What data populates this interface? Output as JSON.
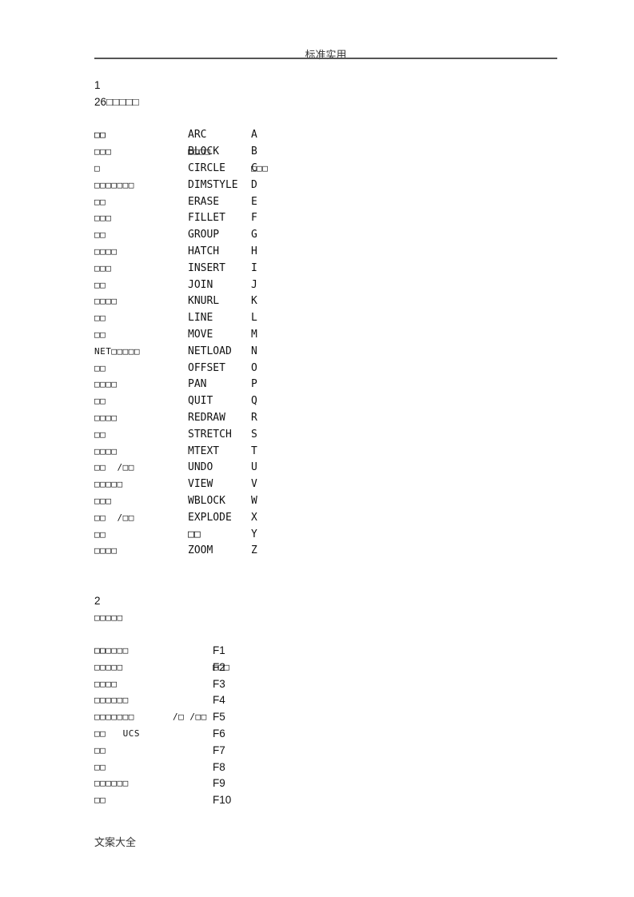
{
  "header": {
    "title": "标准实用"
  },
  "footer": {
    "text": "文案大全"
  },
  "section1": {
    "number": "1",
    "heading": "26□□□□□",
    "columns": [
      "□□",
      "□□□□",
      "□□□"
    ],
    "rows": [
      {
        "name": "□□",
        "command": "ARC",
        "key": "A"
      },
      {
        "name": "□□□",
        "command": "BLOCK",
        "key": "B"
      },
      {
        "name": "□",
        "command": "CIRCLE",
        "key": "C"
      },
      {
        "name": "□□□□□□□",
        "command": "DIMSTYLE",
        "key": "D"
      },
      {
        "name": "□□",
        "command": "ERASE",
        "key": "E"
      },
      {
        "name": "□□□",
        "command": "FILLET",
        "key": "F"
      },
      {
        "name": "□□",
        "command": "GROUP",
        "key": "G"
      },
      {
        "name": "□□□□",
        "command": "HATCH",
        "key": "H"
      },
      {
        "name": "□□□",
        "command": "INSERT",
        "key": "I"
      },
      {
        "name": "□□",
        "command": "JOIN",
        "key": "J"
      },
      {
        "name": "□□□□",
        "command": "KNURL",
        "key": "K"
      },
      {
        "name": "□□",
        "command": "LINE",
        "key": "L"
      },
      {
        "name": "□□",
        "command": "MOVE",
        "key": "M"
      },
      {
        "name": "NET□□□□□",
        "command": "NETLOAD",
        "key": "N"
      },
      {
        "name": "□□",
        "command": "OFFSET",
        "key": "O"
      },
      {
        "name": "□□□□",
        "command": "PAN",
        "key": "P"
      },
      {
        "name": "□□",
        "command": "QUIT",
        "key": "Q"
      },
      {
        "name": "□□□□",
        "command": "REDRAW",
        "key": "R"
      },
      {
        "name": "□□",
        "command": "STRETCH",
        "key": "S"
      },
      {
        "name": "□□□□",
        "command": "MTEXT",
        "key": "T"
      },
      {
        "name": "□□  /□□",
        "command": "UNDO",
        "key": "U"
      },
      {
        "name": "□□□□□",
        "command": "VIEW",
        "key": "V"
      },
      {
        "name": "□□□",
        "command": "WBLOCK",
        "key": "W"
      },
      {
        "name": "□□  /□□",
        "command": "EXPLODE",
        "key": "X"
      },
      {
        "name": "□□",
        "command": "□□",
        "key": "Y"
      },
      {
        "name": "□□□□",
        "command": "ZOOM",
        "key": "Z"
      }
    ]
  },
  "section2": {
    "number": "2",
    "heading": "□□□□□",
    "columns": [
      "□□",
      "□□□"
    ],
    "rows": [
      {
        "name": "□□□□□□",
        "mid": "",
        "key": "F1"
      },
      {
        "name": "□□□□□",
        "mid": "",
        "key": "F2"
      },
      {
        "name": "□□□□",
        "mid": "",
        "key": "F3"
      },
      {
        "name": "□□□□□□",
        "mid": "",
        "key": "F4"
      },
      {
        "name": "□□□□□□□",
        "mid": "/□ /□□",
        "key": "F5"
      },
      {
        "name": "□□   UCS",
        "mid": "",
        "key": "F6"
      },
      {
        "name": "□□",
        "mid": "",
        "key": "F7"
      },
      {
        "name": "□□",
        "mid": "",
        "key": "F8"
      },
      {
        "name": "□□□□□□",
        "mid": "",
        "key": "F9"
      },
      {
        "name": "□□",
        "mid": "",
        "key": "F10"
      }
    ]
  }
}
